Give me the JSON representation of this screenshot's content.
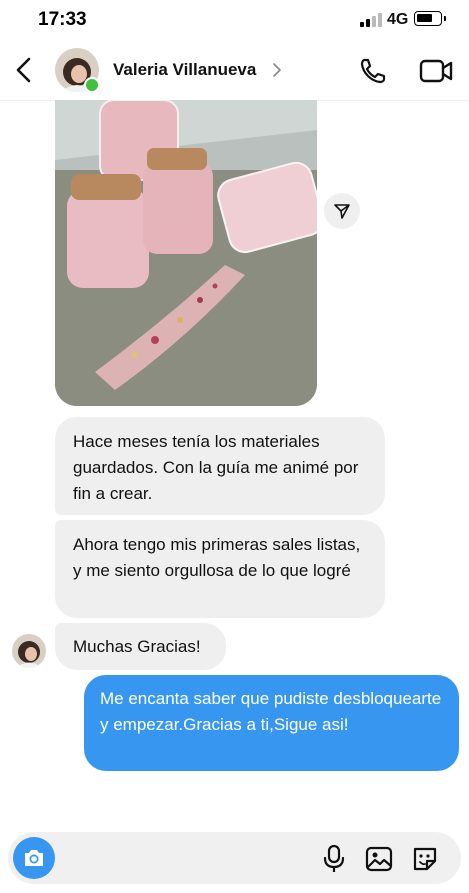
{
  "status_bar": {
    "time": "17:33",
    "network": "4G"
  },
  "header": {
    "contact_name": "Valeria Villanueva",
    "online": true
  },
  "messages": [
    {
      "from": "contact",
      "type": "image"
    },
    {
      "from": "contact",
      "text": "Hace meses tenía los materiales guardados. Con la guía me animé por fin a crear."
    },
    {
      "from": "contact",
      "text": "Ahora tengo mis primeras sales listas, y me siento orgullosa de lo que logré"
    },
    {
      "from": "contact",
      "text": "Muchas Gracias!"
    },
    {
      "from": "me",
      "text": "Me encanta saber que pudiste desbloquearte y empezar.Gracias a ti,Sigue asi!"
    }
  ],
  "composer": {
    "placeholder": ""
  },
  "icons": {
    "back": "chevron-left-icon",
    "call": "phone-icon",
    "video": "video-camera-icon",
    "share": "send-icon",
    "camera": "camera-icon",
    "mic": "microphone-icon",
    "gallery": "image-icon",
    "sticker": "sticker-icon"
  },
  "colors": {
    "outgoing_bubble": "#3797f0",
    "incoming_bubble": "#efefef",
    "online_dot": "#3cc23f"
  }
}
